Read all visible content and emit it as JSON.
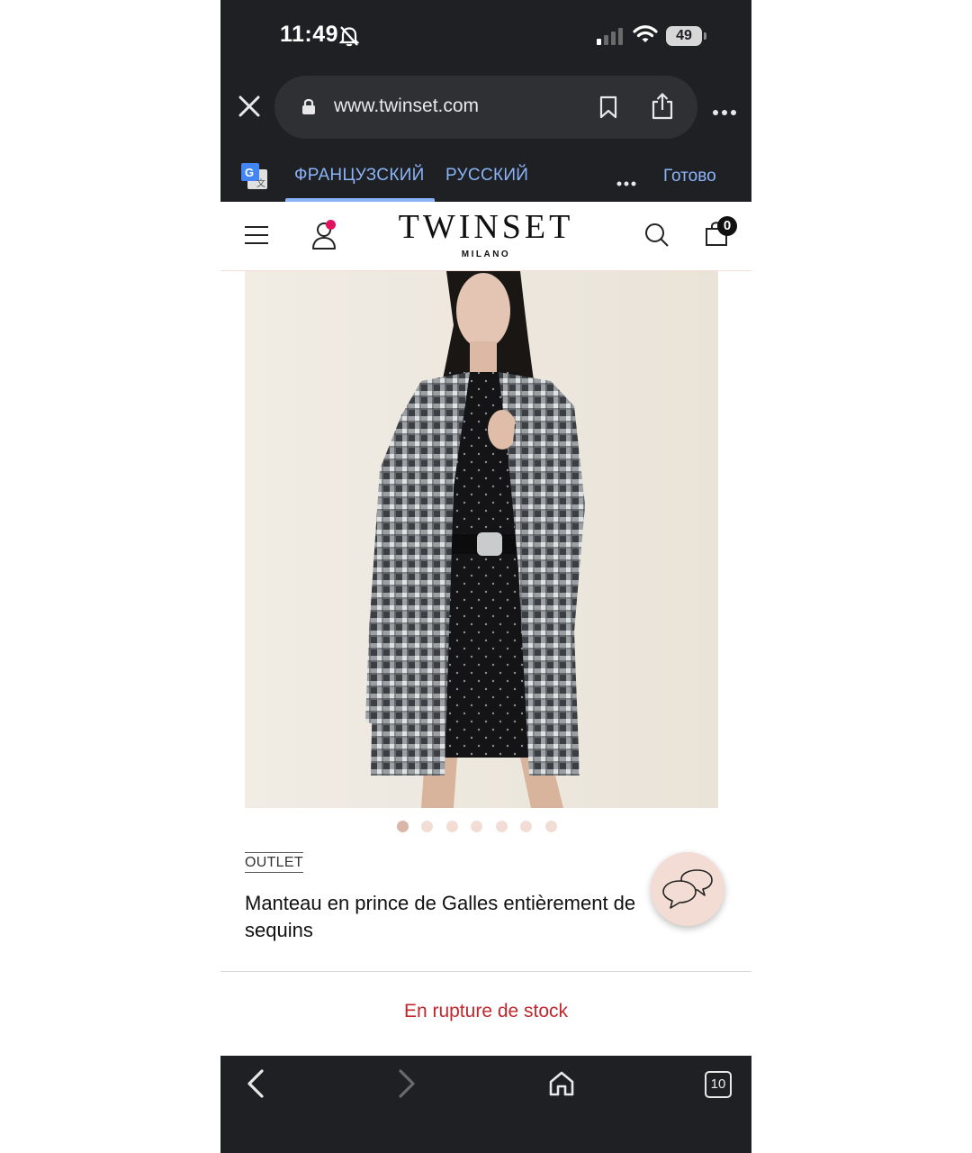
{
  "status_bar": {
    "time": "11:49",
    "battery": "49"
  },
  "browser": {
    "url": "www.twinset.com"
  },
  "translate_bar": {
    "source_lang": "ФРАНЦУЗСКИЙ",
    "target_lang": "РУССКИЙ",
    "done_label": "Готово"
  },
  "site": {
    "logo": "TWINSET",
    "logo_sub": "MILANO",
    "cart_count": "0"
  },
  "product": {
    "image_count": 7,
    "active_image": 1,
    "tag": "OUTLET",
    "title": "Manteau en prince de Galles entièrement de sequins",
    "stock_status": "En rupture de stock"
  },
  "bottom_nav": {
    "tab_count": "10"
  },
  "colors": {
    "browser_chrome": "#1f2023",
    "accent_blue": "#8ab4f8",
    "out_of_stock_red": "#c0282d",
    "notification_pink": "#e0115f"
  }
}
